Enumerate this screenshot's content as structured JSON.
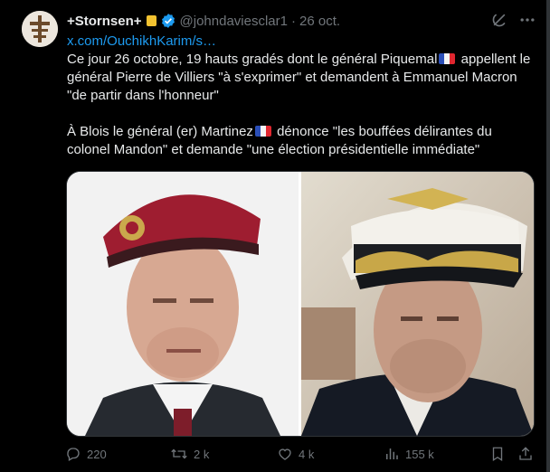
{
  "tweet": {
    "author_name": "+Stornsen+",
    "handle": "@johndaviesclar1",
    "separator": "·",
    "date": "26 oct.",
    "link": "x.com/OuchikhKarim/s…",
    "para1_a": "Ce jour 26 octobre, 19 hauts gradés dont le général Piquemal",
    "para1_b": " appellent le général Pierre de Villiers \"à s'exprimer\" et demandent à Emmanuel Macron \"de partir dans l'honneur\"",
    "para2_a": "À Blois le général (er) Martinez",
    "para2_b": " dénonce \"les bouffées délirantes du colonel Mandon\" et demande \"une élection présidentielle immédiate\""
  },
  "actions": {
    "replies": "220",
    "reposts": "2 k",
    "likes": "4 k",
    "views": "155 k"
  },
  "colors": {
    "background": "#000000",
    "text": "#e7e9ea",
    "muted": "#71767b",
    "link": "#1d9bf0",
    "verified": "#1d9bf0",
    "badge": "#f2c230"
  },
  "icons": [
    "grok-icon",
    "more-icon",
    "verified-icon",
    "flag-fr-icon",
    "reply-icon",
    "repost-icon",
    "like-icon",
    "views-icon",
    "bookmark-icon",
    "share-icon"
  ]
}
